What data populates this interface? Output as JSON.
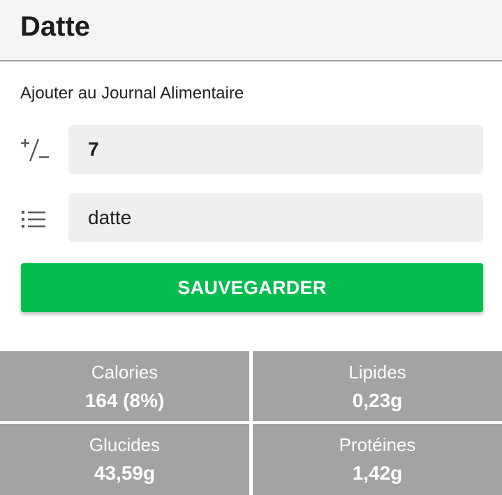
{
  "header": {
    "title": "Datte"
  },
  "form": {
    "section_title": "Ajouter au Journal Alimentaire",
    "quantity": {
      "icon": "plus-minus-icon",
      "value": "7"
    },
    "food": {
      "icon": "list-icon",
      "value": "datte"
    },
    "save_label": "SAUVEGARDER"
  },
  "colors": {
    "accent": "#05bd4f",
    "cell_background": "#a3a3a3"
  },
  "nutrition": [
    {
      "label": "Calories",
      "value": "164 (8%)"
    },
    {
      "label": "Lipides",
      "value": "0,23g"
    },
    {
      "label": "Glucides",
      "value": "43,59g"
    },
    {
      "label": "Protéines",
      "value": "1,42g"
    }
  ]
}
